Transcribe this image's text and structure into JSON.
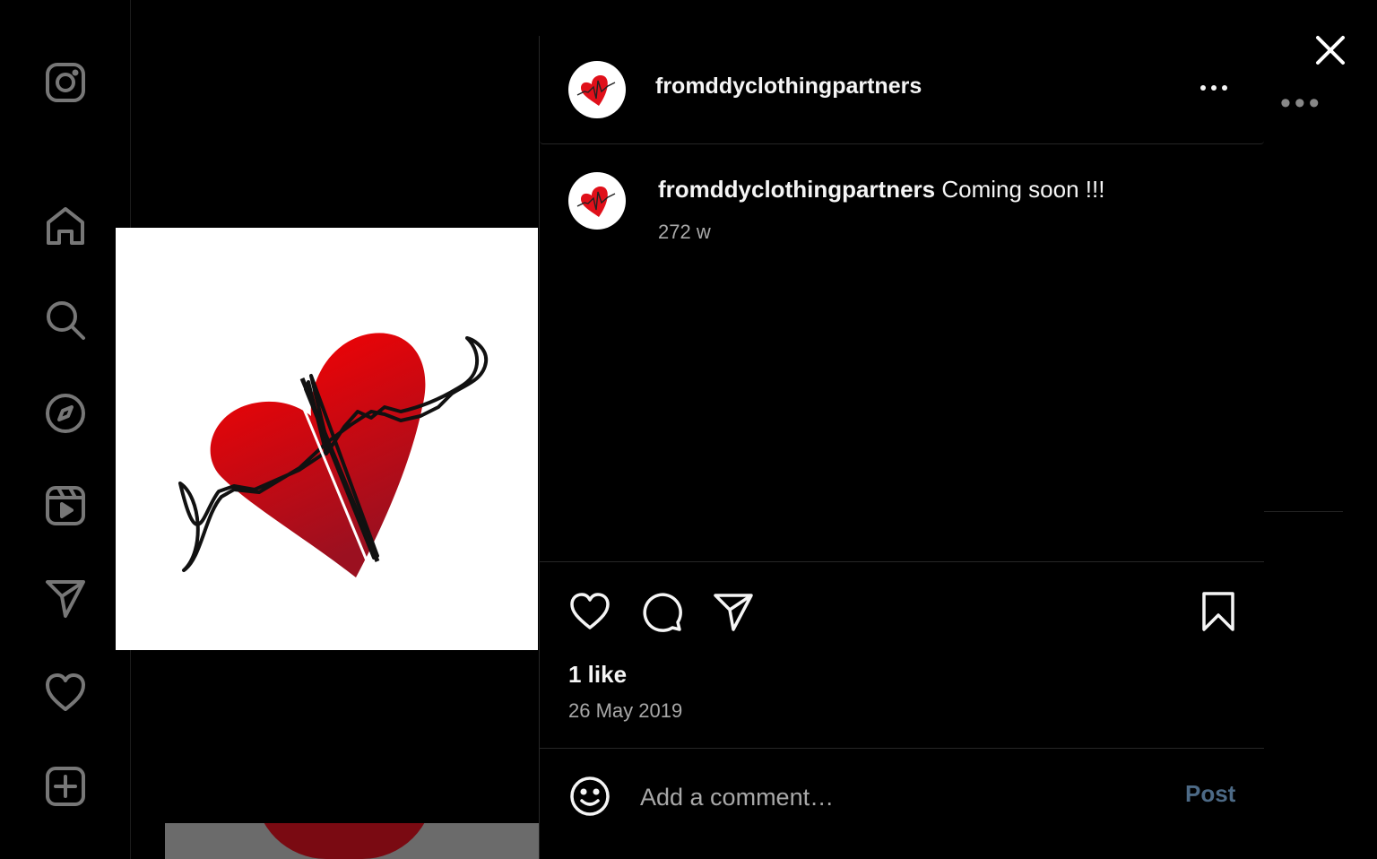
{
  "post": {
    "username": "fromddyclothingpartners",
    "caption_user": "fromddyclothingpartners",
    "caption_text": " Coming soon !!!",
    "caption_time": "272 w",
    "likes": "1 like",
    "date": "26 May 2019"
  },
  "comment": {
    "placeholder": "Add a comment…",
    "post_label": "Post"
  },
  "sidebar": {
    "items": [
      {
        "icon": "instagram-logo-icon"
      },
      {
        "icon": "home-icon"
      },
      {
        "icon": "search-icon"
      },
      {
        "icon": "explore-compass-icon"
      },
      {
        "icon": "reels-icon"
      },
      {
        "icon": "messages-send-icon"
      },
      {
        "icon": "notifications-heart-icon"
      },
      {
        "icon": "create-plus-icon"
      }
    ]
  },
  "colors": {
    "background": "#000000",
    "text": "#f5f5f5",
    "secondary_text": "#a8a8a8",
    "divider": "#262626",
    "post_button": "#4d6a86",
    "heart_red": "#e0101a"
  }
}
